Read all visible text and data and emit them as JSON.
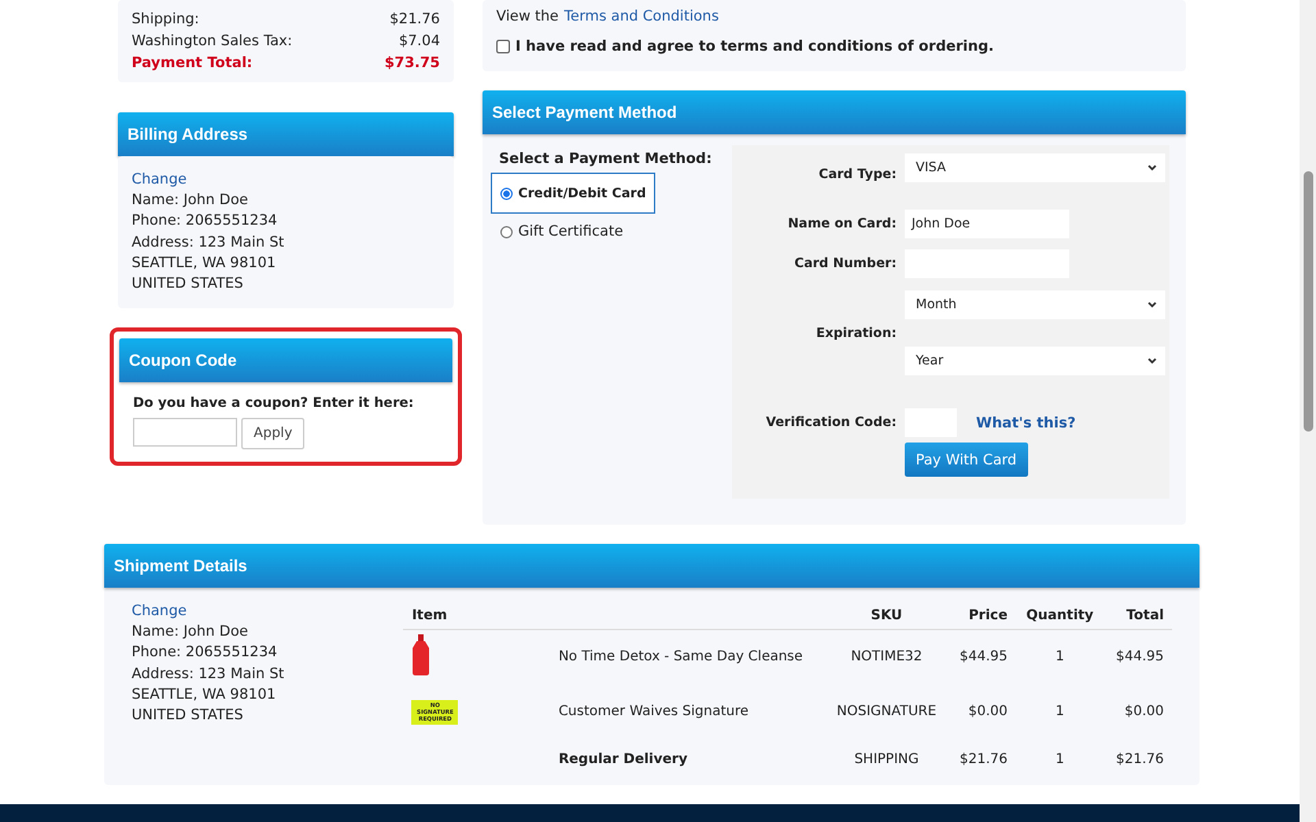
{
  "summary": {
    "rows": [
      {
        "label": "Shipping:",
        "value": "$21.76",
        "kind": "normal"
      },
      {
        "label": "Washington Sales Tax:",
        "value": "$7.04",
        "kind": "normal"
      },
      {
        "label": "Payment Total:",
        "value": "$73.75",
        "kind": "total"
      }
    ]
  },
  "terms": {
    "prefix": "View the",
    "link": "Terms and Conditions",
    "agree": {
      "label": "I have read and agree to terms and conditions of ordering.",
      "checked": false
    }
  },
  "billing": {
    "title": "Billing Address",
    "change": "Change",
    "lines": [
      "Name: John Doe",
      "Phone: 2065551234",
      "Address: 123 Main St",
      "SEATTLE, WA 98101",
      "UNITED STATES"
    ]
  },
  "coupon": {
    "title": "Coupon Code",
    "prompt": "Do you have a coupon? Enter it here:",
    "button": "Apply",
    "highlighted": true
  },
  "payment": {
    "title": "Select Payment Method",
    "prompt": "Select a Payment Method:",
    "methods": [
      {
        "label": "Credit/Debit Card",
        "selected": true
      },
      {
        "label": "Gift Certificate",
        "selected": false
      }
    ],
    "form": {
      "card_type": {
        "label": "Card Type:",
        "value": "VISA"
      },
      "name": {
        "label": "Name on Card:",
        "value": "John Doe"
      },
      "number": {
        "label": "Card Number:"
      },
      "expiration": {
        "label": "Expiration:",
        "month": "Month",
        "year": "Year"
      },
      "verification": {
        "label": "Verification Code:",
        "help": "What's this?"
      },
      "submit": "Pay With Card"
    }
  },
  "shipment": {
    "title": "Shipment Details",
    "change": "Change",
    "lines": [
      "Name: John Doe",
      "Phone: 2065551234",
      "Address: 123 Main St",
      "SEATTLE, WA 98101",
      "UNITED STATES"
    ],
    "table": {
      "columns": [
        "Item",
        "SKU",
        "Price",
        "Quantity",
        "Total"
      ],
      "rows": [
        {
          "kind": "bottle",
          "item": "No Time Detox - Same Day Cleanse",
          "sku": "NOTIME32",
          "price": "$44.95",
          "quantity": "1",
          "total": "$44.95",
          "bold": false
        },
        {
          "kind": "sign",
          "sign_text": "NO SIGNATURE REQUIRED",
          "item": "Customer Waives Signature",
          "sku": "NOSIGNATURE",
          "price": "$0.00",
          "quantity": "1",
          "total": "$0.00",
          "bold": false
        },
        {
          "kind": "text",
          "item": "Regular Delivery",
          "sku": "SHIPPING",
          "price": "$21.76",
          "quantity": "1",
          "total": "$21.76",
          "bold": true
        }
      ]
    }
  }
}
